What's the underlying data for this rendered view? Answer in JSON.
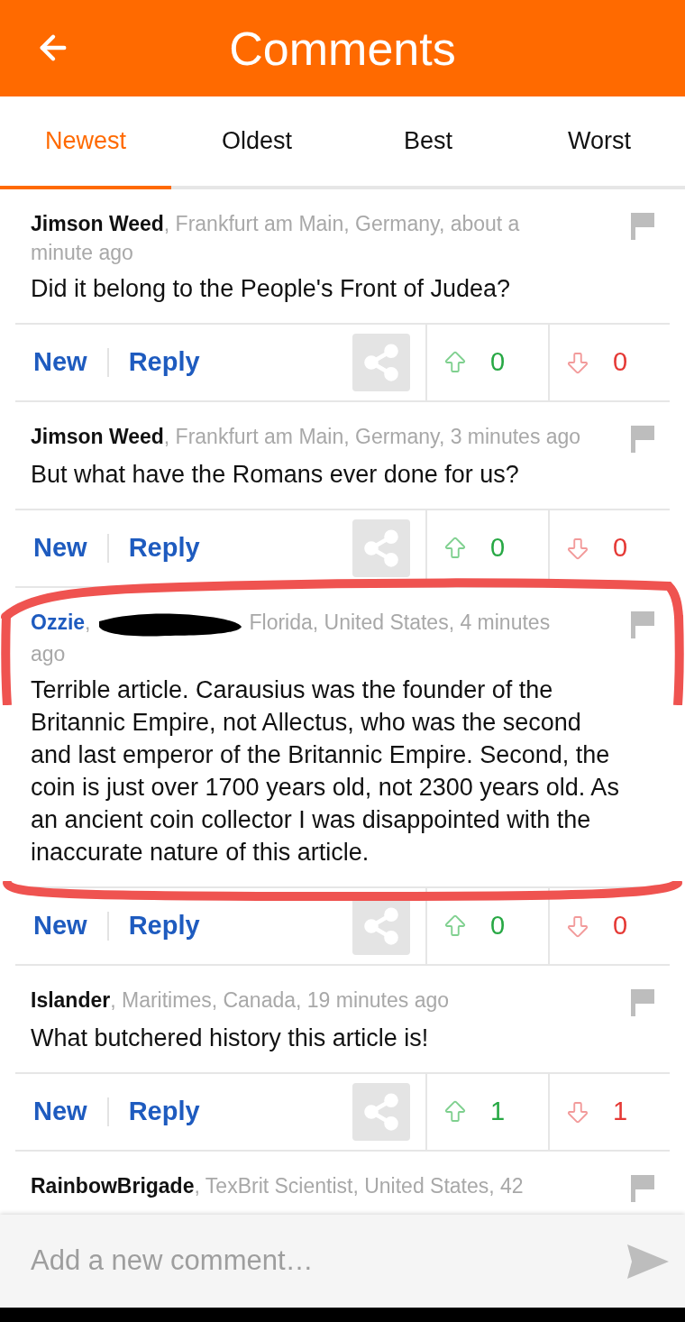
{
  "header": {
    "title": "Comments"
  },
  "tabs": [
    {
      "label": "Newest",
      "selected": true
    },
    {
      "label": "Oldest",
      "selected": false
    },
    {
      "label": "Best",
      "selected": false
    },
    {
      "label": "Worst",
      "selected": false
    }
  ],
  "comments": [
    {
      "author": "Jimson Weed",
      "highlighted": false,
      "annotated": false,
      "meta": [
        ", Frankfurt am Main, Germany, about a minute ago"
      ],
      "body": "Did it belong to the People's Front of Judea?",
      "actions": {
        "new": "New",
        "reply": "Reply",
        "upvotes": "0",
        "downvotes": "0"
      }
    },
    {
      "author": "Jimson Weed",
      "highlighted": false,
      "annotated": false,
      "meta": [
        ", Frankfurt am Main, Germany, 3 minutes ago"
      ],
      "body": "But what have the Romans ever done for us?",
      "actions": {
        "new": "New",
        "reply": "Reply",
        "upvotes": "0",
        "downvotes": "0"
      }
    },
    {
      "author": "Ozzie",
      "highlighted": true,
      "annotated": true,
      "meta": [
        ",",
        "Florida, United States, 4 minutes ago"
      ],
      "body": "Terrible article. Carausius was the founder of the Britannic Empire, not Allectus, who was the second and last emperor of the Britannic Empire. Second, the coin is just over 1700 years old, not 2300 years old. As an ancient coin collector I was disappointed with the inaccurate nature of this article.",
      "actions": {
        "new": "New",
        "reply": "Reply",
        "upvotes": "0",
        "downvotes": "0"
      }
    },
    {
      "author": "Islander",
      "highlighted": false,
      "annotated": false,
      "meta": [
        ", Maritimes, Canada, 19 minutes ago"
      ],
      "body": "What butchered history this article is!",
      "actions": {
        "new": "New",
        "reply": "Reply",
        "upvotes": "1",
        "downvotes": "1"
      }
    },
    {
      "author": "RainbowBrigade",
      "highlighted": false,
      "annotated": false,
      "meta": [
        ", TexBrit Scientist, United States, 42"
      ]
    }
  ],
  "composer": {
    "placeholder": "Add a new comment…"
  }
}
